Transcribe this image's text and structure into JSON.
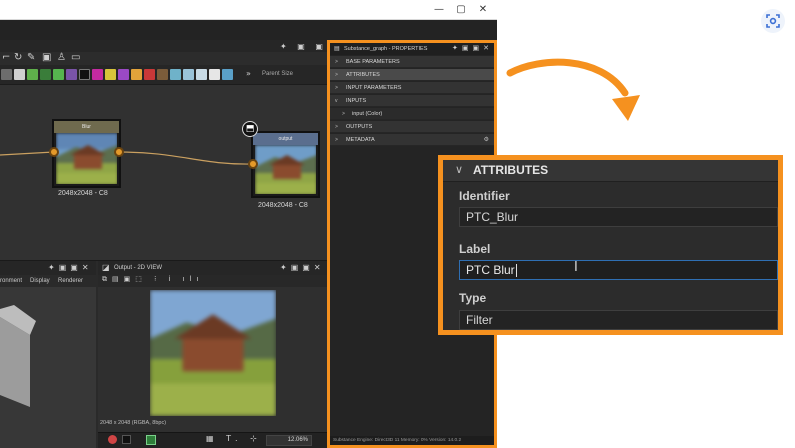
{
  "window": {
    "controls": [
      "—",
      "▢",
      "✕"
    ]
  },
  "graph": {
    "parent_size_label": "Parent Size",
    "panel_icons": "✦ ▣ ▣ ✕",
    "nodes": [
      {
        "title": "Blur",
        "caption": "2048x2048 - C8"
      },
      {
        "title": "output",
        "caption": "2048x2048 - C8"
      }
    ],
    "node_icon": "output-node-icon"
  },
  "scene_panel": {
    "tabs": [
      "ronment",
      "Display",
      "Renderer"
    ]
  },
  "view2d": {
    "title": "Output - 2D VIEW",
    "image_info": "2048 x 2048 (RGBA, 8bpc)",
    "zoom": "12.06%"
  },
  "properties": {
    "title": "Substance_graph - PROPERTIES",
    "rows": [
      {
        "label": "BASE PARAMETERS",
        "chevron": ">"
      },
      {
        "label": "ATTRIBUTES",
        "chevron": ">"
      },
      {
        "label": "INPUT PARAMETERS",
        "chevron": ">"
      },
      {
        "label": "INPUTS",
        "chevron": "v"
      },
      {
        "label": "input (Color)",
        "chevron": ">"
      },
      {
        "label": "OUTPUTS",
        "chevron": ">"
      },
      {
        "label": "METADATA",
        "chevron": ">"
      }
    ],
    "status": "Substance Engine: Direct3D 11  Memory: 0%        Version: 14.0.2"
  },
  "callout": {
    "section_title": "ATTRIBUTES",
    "identifier_label": "Identifier",
    "identifier_value": "PTC_Blur",
    "label_label": "Label",
    "label_value": "PTC Blur",
    "type_label": "Type",
    "type_value": "Filter"
  },
  "colors": {
    "accent_orange": "#f5911f",
    "panel_dark": "#242424",
    "port_orange": "#e49a2a",
    "field_focus_blue": "#2f6fb3"
  }
}
